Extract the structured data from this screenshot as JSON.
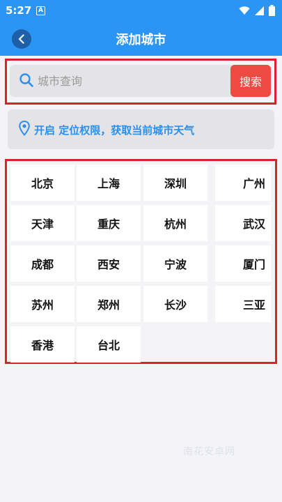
{
  "status": {
    "time": "5:27",
    "app_badge": "A"
  },
  "header": {
    "title": "添加城市"
  },
  "search": {
    "placeholder": "城市查询",
    "button_label": "搜索"
  },
  "location": {
    "text": "开启 定位权限，获取当前城市天气"
  },
  "cities": [
    "北京",
    "上海",
    "深圳",
    "广州",
    "天津",
    "重庆",
    "杭州",
    "武汉",
    "成都",
    "西安",
    "宁波",
    "厦门",
    "苏州",
    "郑州",
    "长沙",
    "三亚",
    "香港",
    "台北"
  ],
  "watermark": "南花安卓网",
  "colors": {
    "accent": "#2b95f5",
    "highlight": "#d8232f",
    "search_button": "#ef4a42",
    "location_text": "#2b8ff0"
  }
}
